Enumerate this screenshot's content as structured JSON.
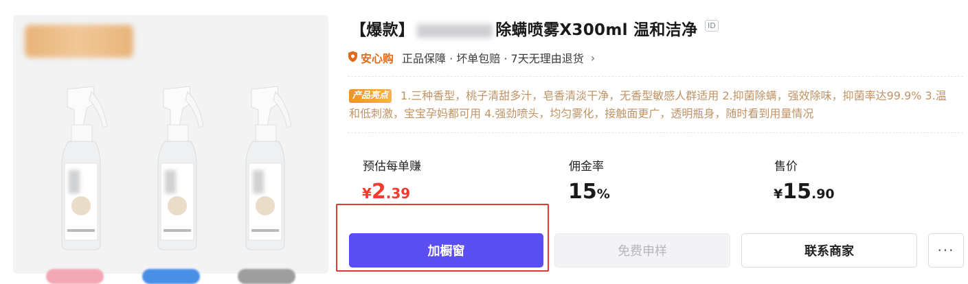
{
  "product": {
    "title_prefix": "【爆款】",
    "title_suffix": "除螨喷雾X300ml 温和洁净",
    "id_tag": "ID"
  },
  "guarantee": {
    "brand": "安心购",
    "text": "正品保障 · 坏单包赔 · 7天无理由退货",
    "chevron": "›"
  },
  "highlights": {
    "badge": "产品亮点",
    "text": "1.三种香型，桃子清甜多汁，皂香清淡干净，无香型敏感人群适用 2.抑菌除螨，强效除味，抑菌率达99.9% 3.温和低刺激，宝宝孕妈都可用 4.强劲喷头，均匀雾化，接触面更广，透明瓶身，随时看到用量情况"
  },
  "metrics": {
    "earn_label": "预估每单赚",
    "earn_currency": "¥",
    "earn_int": "2",
    "earn_dec": ".39",
    "commission_label": "佣金率",
    "commission_int": "15",
    "commission_unit": "%",
    "price_label": "售价",
    "price_currency": "¥",
    "price_int": "15",
    "price_dec": ".90"
  },
  "actions": {
    "add_window": "加橱窗",
    "free_sample": "免费申样",
    "contact_merchant": "联系商家",
    "more": "···"
  },
  "colors": {
    "primary": "#5b4ef0",
    "price_red": "#f23b2f",
    "guarantee_orange": "#e06a18",
    "highlight_text": "#c09365",
    "annotation_red": "#e23a32"
  }
}
